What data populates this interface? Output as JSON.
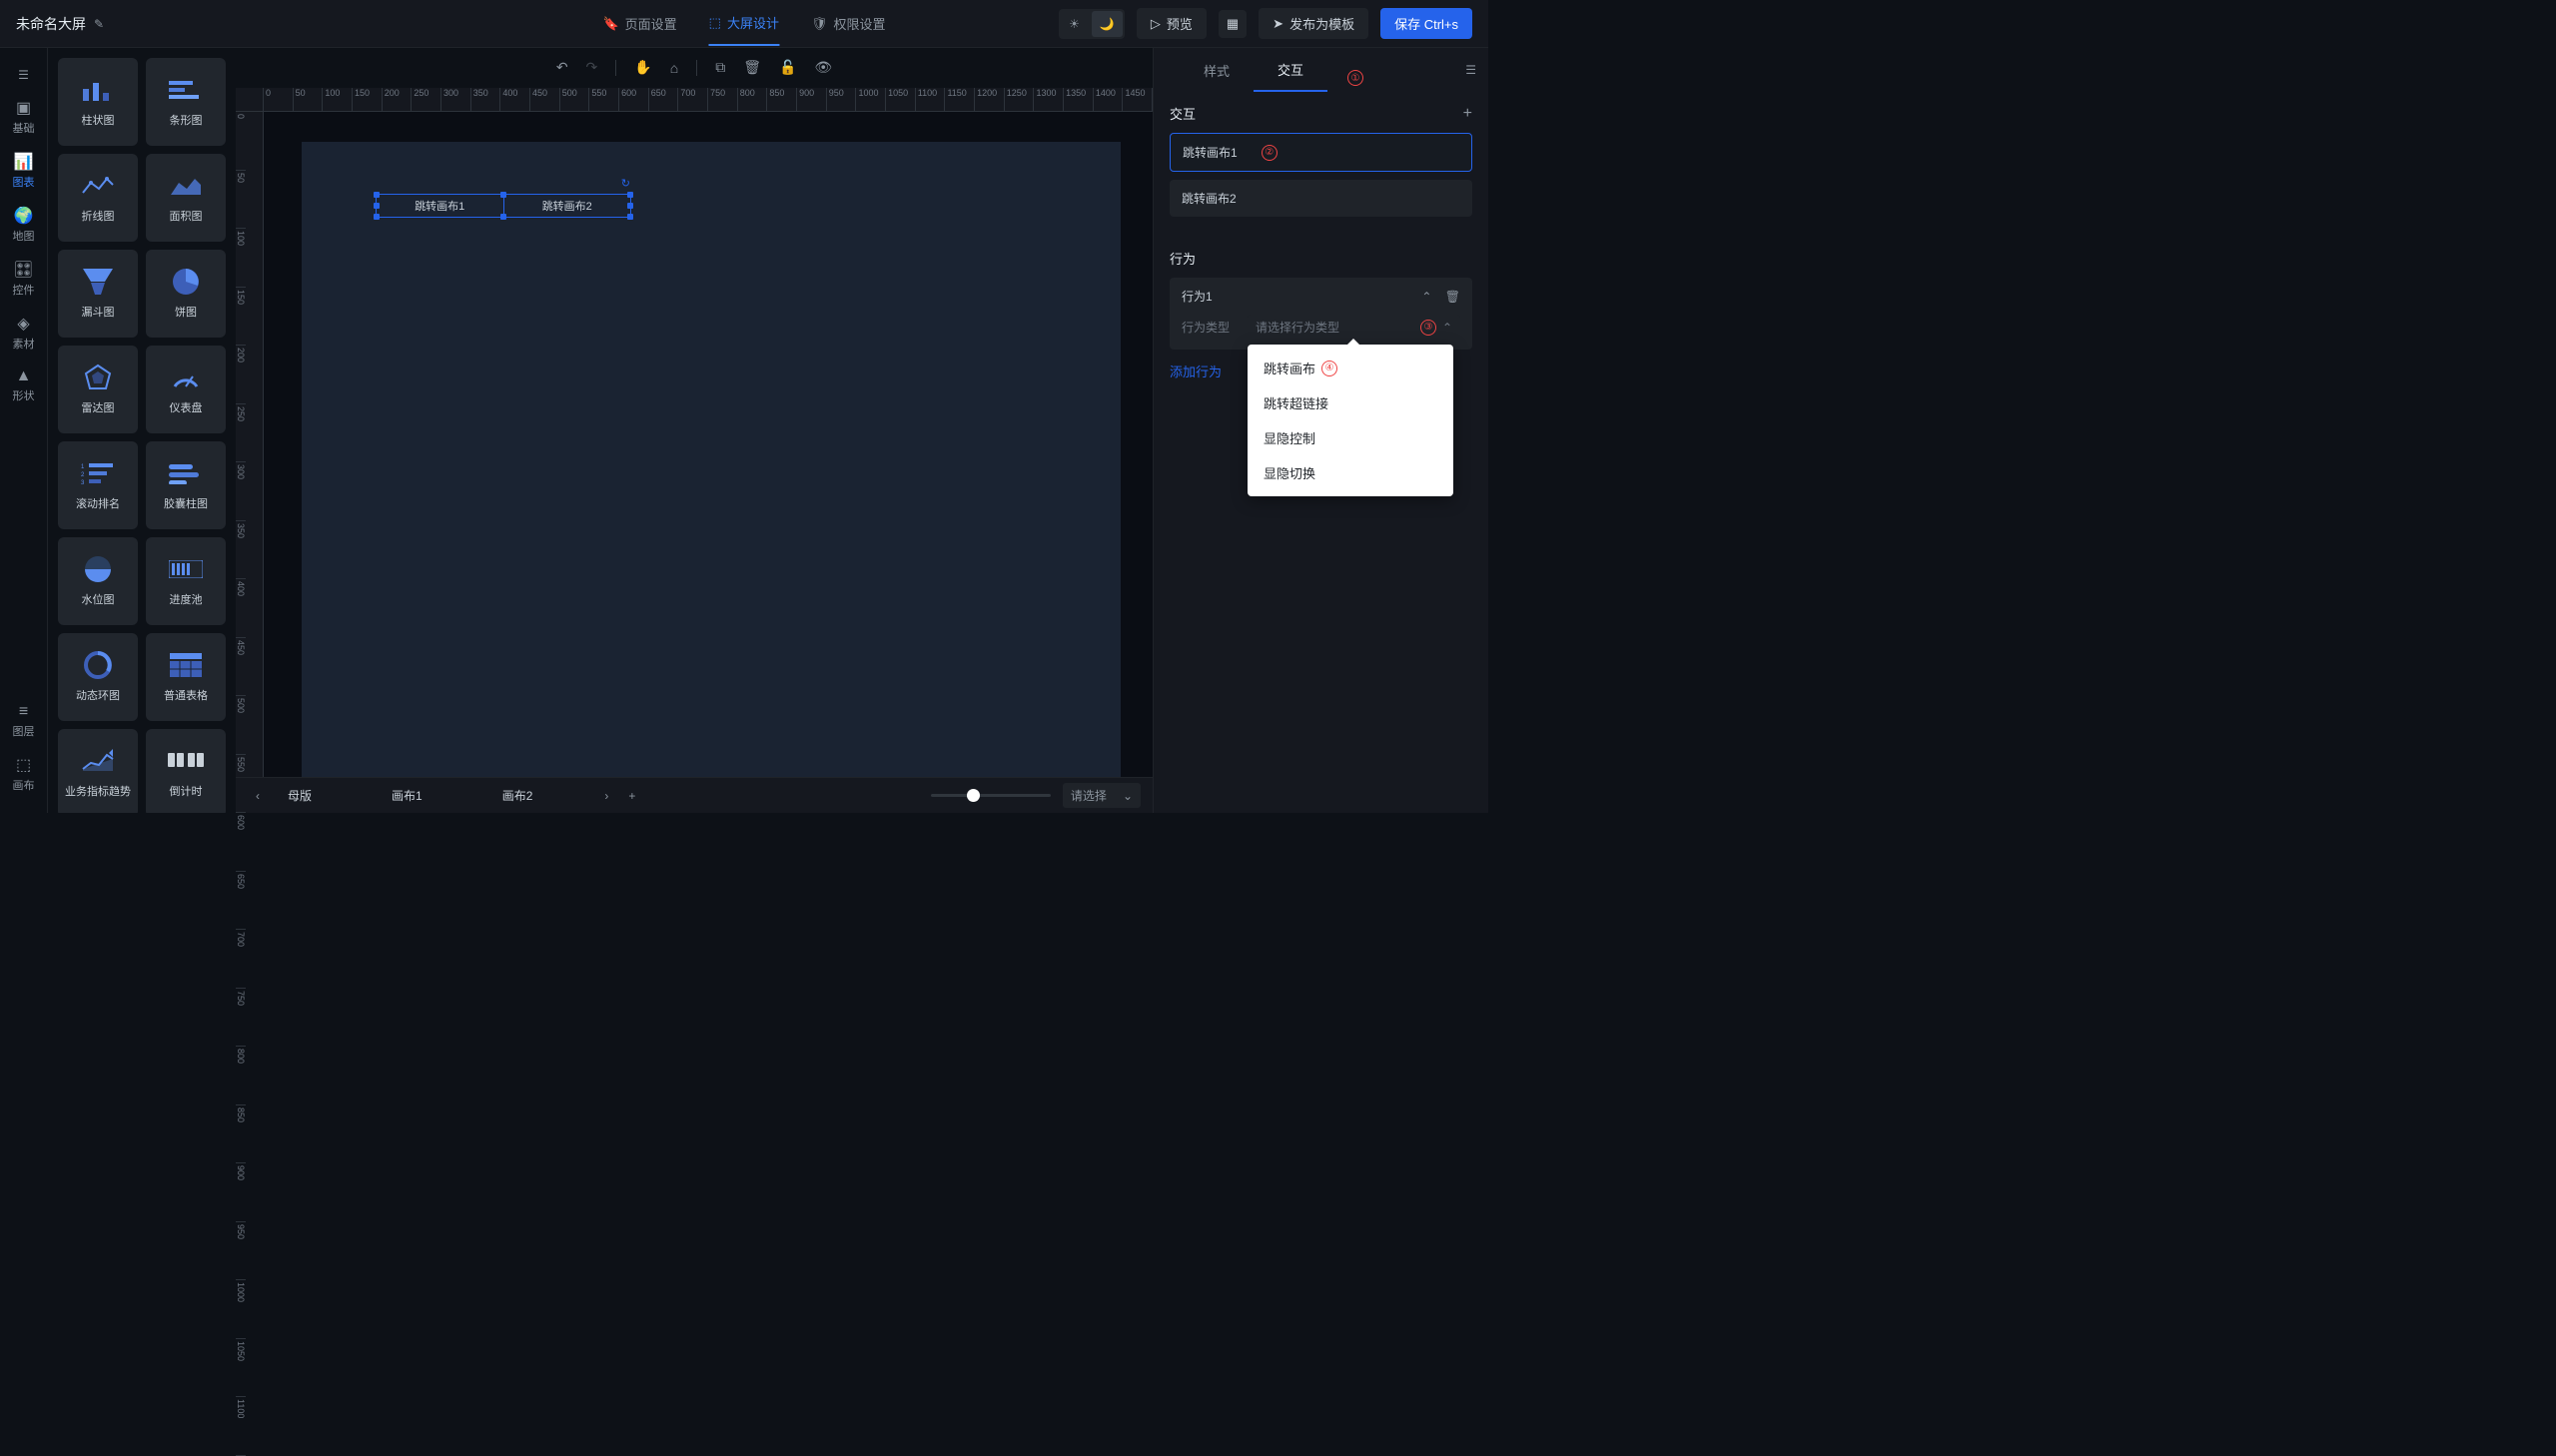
{
  "title": "未命名大屏",
  "topTabs": [
    {
      "label": "页面设置",
      "icon": "bookmark-icon"
    },
    {
      "label": "大屏设计",
      "icon": "grid-icon",
      "active": true
    },
    {
      "label": "权限设置",
      "icon": "shield-icon"
    }
  ],
  "topButtons": {
    "preview": "预览",
    "publish": "发布为模板",
    "save": "保存 Ctrl+s"
  },
  "leftNav": [
    {
      "label": "基础",
      "icon": "basic"
    },
    {
      "label": "图表",
      "icon": "chart",
      "active": true
    },
    {
      "label": "地图",
      "icon": "map"
    },
    {
      "label": "控件",
      "icon": "control"
    },
    {
      "label": "素材",
      "icon": "material"
    },
    {
      "label": "形状",
      "icon": "shape"
    }
  ],
  "leftNavBottom": [
    {
      "label": "图层",
      "icon": "layers"
    },
    {
      "label": "画布",
      "icon": "canvas"
    }
  ],
  "components": [
    {
      "label": "柱状图"
    },
    {
      "label": "条形图"
    },
    {
      "label": "折线图"
    },
    {
      "label": "面积图"
    },
    {
      "label": "漏斗图"
    },
    {
      "label": "饼图"
    },
    {
      "label": "雷达图"
    },
    {
      "label": "仪表盘"
    },
    {
      "label": "滚动排名"
    },
    {
      "label": "胶囊柱图"
    },
    {
      "label": "水位图"
    },
    {
      "label": "进度池"
    },
    {
      "label": "动态环图"
    },
    {
      "label": "普通表格"
    },
    {
      "label": "业务指标趋势"
    },
    {
      "label": "倒计时"
    }
  ],
  "rulerH": [
    "0",
    "50",
    "100",
    "150",
    "200",
    "250",
    "300",
    "350",
    "400",
    "450",
    "500",
    "550",
    "600",
    "650",
    "700",
    "750",
    "800",
    "850",
    "900",
    "950",
    "1000",
    "1050",
    "1100",
    "1150",
    "1200",
    "1250",
    "1300",
    "1350",
    "1400",
    "1450"
  ],
  "rulerV": [
    "0",
    "50",
    "100",
    "150",
    "200",
    "250",
    "300",
    "350",
    "400",
    "450",
    "500",
    "550",
    "600",
    "650",
    "700",
    "750",
    "800",
    "850",
    "900",
    "950",
    "1000",
    "1050",
    "1100"
  ],
  "canvasWidget": {
    "tab1": "跳转画布1",
    "tab2": "跳转画布2"
  },
  "bottomTabs": [
    "母版",
    "画布1",
    "画布2"
  ],
  "zoomPlaceholder": "请选择",
  "rightPanel": {
    "tabs": [
      "样式",
      "交互"
    ],
    "activeTab": 1,
    "badge1": "①",
    "interactTitle": "交互",
    "interactItems": [
      "跳转画布1",
      "跳转画布2"
    ],
    "badge2": "②",
    "behaviorTitle": "行为",
    "behavior1": "行为1",
    "behaviorTypeLabel": "行为类型",
    "behaviorTypePlaceholder": "请选择行为类型",
    "badge3": "③",
    "addBehavior": "添加行为",
    "dropdownOptions": [
      "跳转画布",
      "跳转超链接",
      "显隐控制",
      "显隐切换"
    ],
    "badge4": "④"
  }
}
